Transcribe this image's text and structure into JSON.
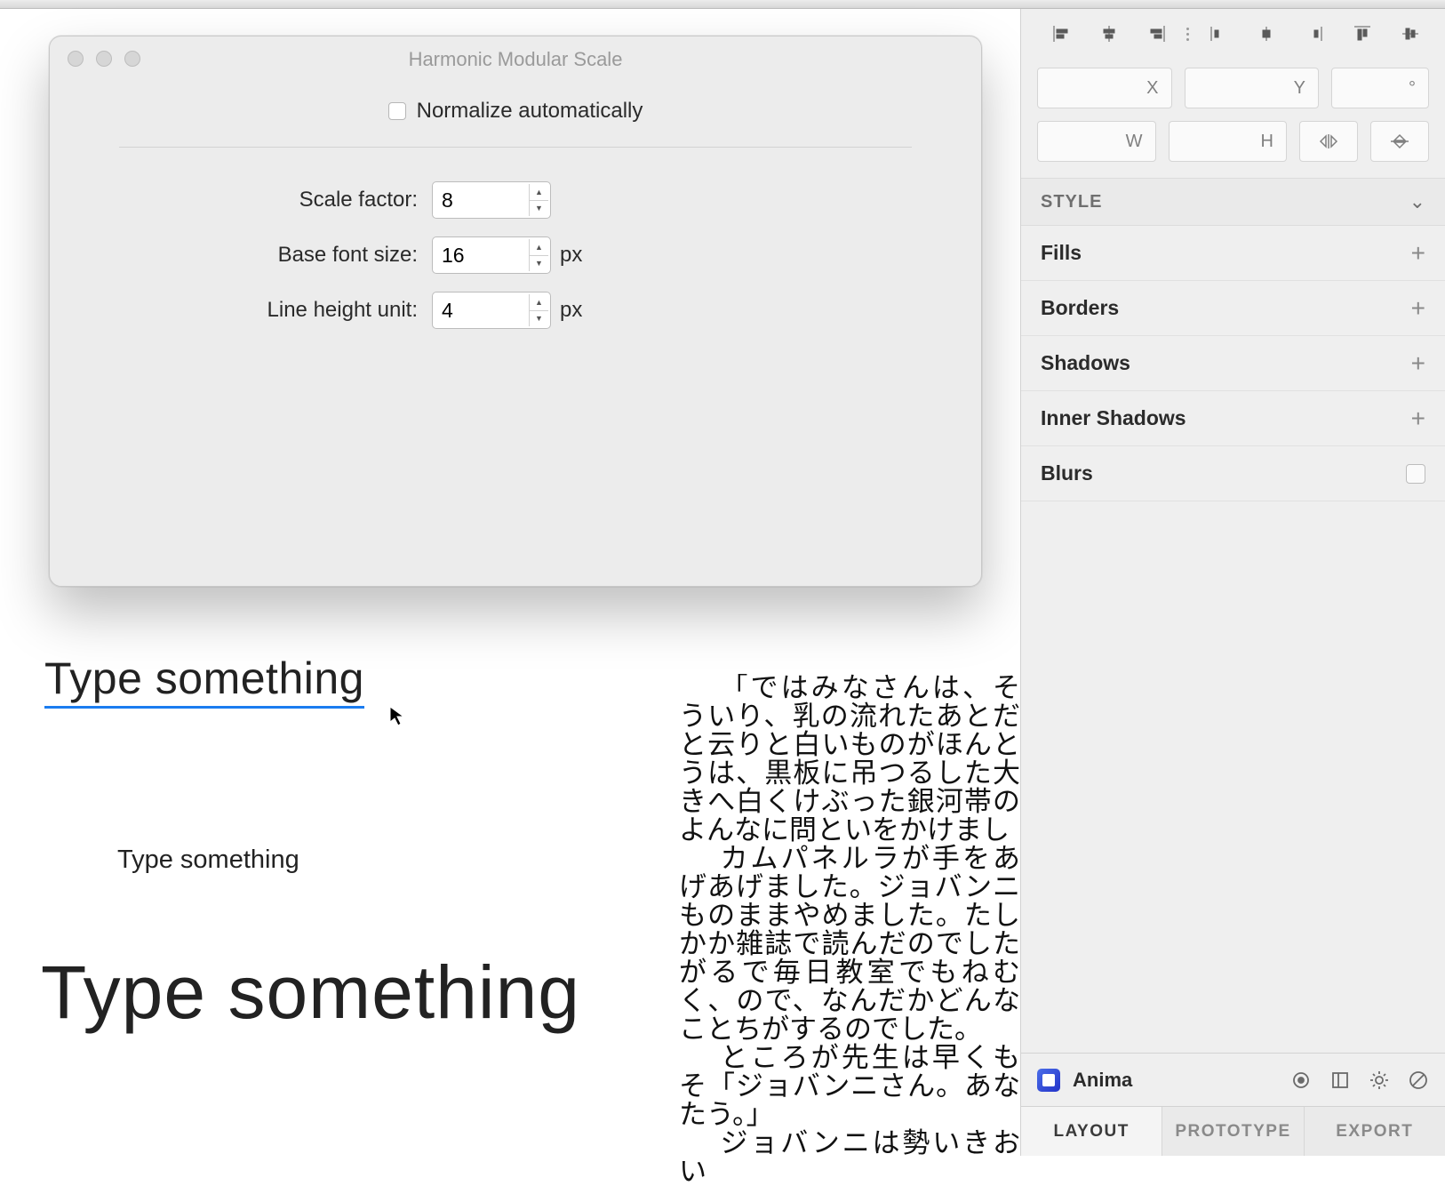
{
  "modal": {
    "title": "Harmonic Modular Scale",
    "normalize_label": "Normalize automatically",
    "fields": {
      "scale_factor": {
        "label": "Scale factor:",
        "value": "8"
      },
      "base_font_size": {
        "label": "Base font size:",
        "value": "16",
        "unit": "px"
      },
      "line_height_unit": {
        "label": "Line height unit:",
        "value": "4",
        "unit": "px"
      }
    }
  },
  "canvas": {
    "text_large_selected": "Type something",
    "text_medium": "Type something",
    "text_xlarge": "Type something",
    "jp_paragraph_1": "「ではみなさんは、そういり、乳の流れたあとだと云りと白いものがほんとうは、黒板に吊つるした大きへ白くけぶった銀河帯のよんなに問といをかけまし",
    "jp_paragraph_2": "カムパネルラが手をあげあげました。ジョバンニものままやめました。たしかか雑誌で読んだのでしたがるで毎日教室でもねむく、ので、なんだかどんなことちがするのでした。",
    "jp_paragraph_3": "ところが先生は早くもそ「ジョバンニさん。あなたう。」",
    "jp_paragraph_4": "ジョバンニは勢いきおい"
  },
  "inspector": {
    "position": {
      "x_label": "X",
      "y_label": "Y",
      "angle_label": "°"
    },
    "size": {
      "w_label": "W",
      "h_label": "H"
    },
    "style_header": "STYLE",
    "sections": {
      "fills": "Fills",
      "borders": "Borders",
      "shadows": "Shadows",
      "inner_shadows": "Inner Shadows",
      "blurs": "Blurs"
    },
    "plugin": {
      "name": "Anima"
    },
    "tabs": {
      "layout": "LAYOUT",
      "prototype": "PROTOTYPE",
      "export": "EXPORT"
    }
  }
}
